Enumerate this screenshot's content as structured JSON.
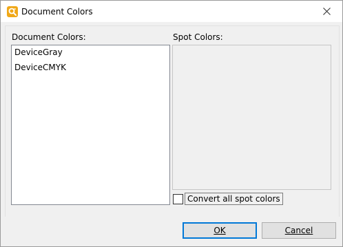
{
  "window": {
    "title": "Document Colors",
    "icon": "pdf-editor-app-icon",
    "close_icon": "close-icon"
  },
  "document_colors": {
    "label": "Document Colors:",
    "items": [
      "DeviceGray",
      "DeviceCMYK"
    ]
  },
  "spot_colors": {
    "label": "Spot Colors:",
    "items": []
  },
  "convert": {
    "label": "Convert all spot colors",
    "checked": false
  },
  "buttons": {
    "ok": "OK",
    "cancel": "Cancel"
  },
  "colors": {
    "app_icon": "#f0a818",
    "focus_border": "#0078d7"
  }
}
